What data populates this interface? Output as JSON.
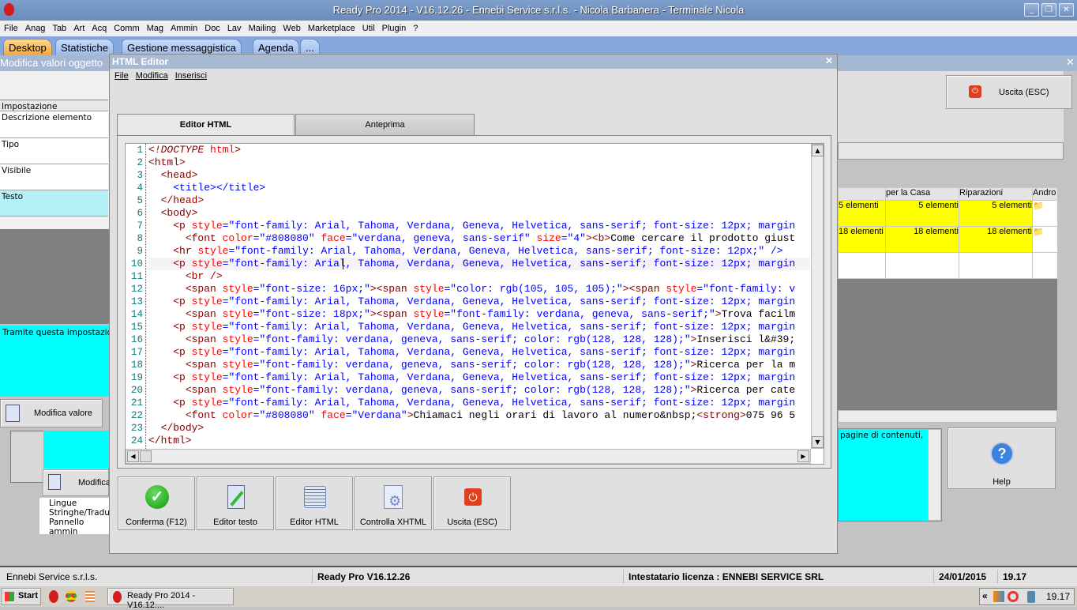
{
  "app": {
    "title": "Ready Pro 2014 - V16.12.26 - Ennebi Service s.r.l.s. - Nicola Barbanera - Terminale Nicola"
  },
  "menu": [
    "File",
    "Anag",
    "Tab",
    "Art",
    "Acq",
    "Comm",
    "Mag",
    "Ammin",
    "Doc",
    "Lav",
    "Mailing",
    "Web",
    "Marketplace",
    "Util",
    "Plugin",
    "?"
  ],
  "tabs": [
    {
      "label": "Desktop",
      "active": true
    },
    {
      "label": "Statistiche"
    },
    {
      "label": "Gestione messaggistica"
    },
    {
      "label": "Agenda"
    },
    {
      "label": "..."
    }
  ],
  "bg_window": {
    "title": "Modifica valori oggetto",
    "header": "Impostazione",
    "props": [
      "Descrizione elemento",
      "Tipo",
      "Visibile",
      "Testo"
    ],
    "description": "Tramite questa impostazione",
    "modify_label": "Modifica valore",
    "modify_label_2": "Modifica",
    "tree": [
      "Lingue",
      "Stringhe/Tradu",
      "Pannello ammin"
    ],
    "exit_label": "Uscita (ESC)",
    "help_label": "Help",
    "help_text": "pagine di contenuti,",
    "grid": {
      "columns": [
        "",
        "per la Casa",
        "Riparazioni",
        "Andro"
      ],
      "rows": [
        [
          "5 elementi",
          "5 elementi",
          "5 elementi",
          ""
        ],
        [
          "18 elementi",
          "18 elementi",
          "18 elementi",
          ""
        ]
      ]
    }
  },
  "editor": {
    "title": "HTML Editor",
    "menu": [
      "File",
      "Modifica",
      "Inserisci"
    ],
    "tabs": [
      "Editor HTML",
      "Anteprima"
    ],
    "active_tab": "Editor HTML",
    "lines": [
      [
        [
          "d",
          "<!DOCTYPE"
        ],
        [
          "a",
          " html"
        ],
        [
          "k",
          ">"
        ]
      ],
      [
        [
          "k",
          "<html>"
        ]
      ],
      [
        [
          "x",
          "  "
        ],
        [
          "k",
          "<head>"
        ]
      ],
      [
        [
          "x",
          "    "
        ],
        [
          "b",
          "<title></title>"
        ]
      ],
      [
        [
          "x",
          "  "
        ],
        [
          "k",
          "</head>"
        ]
      ],
      [
        [
          "x",
          "  "
        ],
        [
          "k",
          "<body>"
        ]
      ],
      [
        [
          "x",
          "    "
        ],
        [
          "k",
          "<p "
        ],
        [
          "a",
          "style"
        ],
        [
          "v",
          "=\"font-family: Arial, Tahoma, Verdana, Geneva, Helvetica, sans-serif; font-size: 12px; margin"
        ]
      ],
      [
        [
          "x",
          "      "
        ],
        [
          "k",
          "<font "
        ],
        [
          "a",
          "color"
        ],
        [
          "v",
          "=\"#808080\" "
        ],
        [
          "a",
          "face"
        ],
        [
          "v",
          "=\"verdana, geneva, sans-serif\" "
        ],
        [
          "a",
          "size"
        ],
        [
          "v",
          "=\"4\""
        ],
        [
          "k",
          "><b>"
        ],
        [
          "x",
          "Come cercare il prodotto giust"
        ]
      ],
      [
        [
          "x",
          "    "
        ],
        [
          "k",
          "<hr "
        ],
        [
          "a",
          "style"
        ],
        [
          "v",
          "=\"font-family: Arial, Tahoma, Verdana, Geneva, Helvetica, sans-serif; font-size: 12px;\" />"
        ]
      ],
      [
        [
          "x",
          "    "
        ],
        [
          "k",
          "<p "
        ],
        [
          "a",
          "style"
        ],
        [
          "v",
          "=\"font-family: Arial, Tahoma, Verdana, Geneva, Helvetica, sans-serif; font-size: 12px; margin"
        ]
      ],
      [
        [
          "x",
          "      "
        ],
        [
          "k",
          "<br />"
        ]
      ],
      [
        [
          "x",
          "      "
        ],
        [
          "k",
          "<span "
        ],
        [
          "a",
          "style"
        ],
        [
          "v",
          "=\"font-size: 16px;\""
        ],
        [
          "k",
          "><span "
        ],
        [
          "a",
          "style"
        ],
        [
          "v",
          "=\"color: rgb(105, 105, 105);\""
        ],
        [
          "k",
          "><span "
        ],
        [
          "a",
          "style"
        ],
        [
          "v",
          "=\"font-family: v"
        ]
      ],
      [
        [
          "x",
          "    "
        ],
        [
          "k",
          "<p "
        ],
        [
          "a",
          "style"
        ],
        [
          "v",
          "=\"font-family: Arial, Tahoma, Verdana, Geneva, Helvetica, sans-serif; font-size: 12px; margin"
        ]
      ],
      [
        [
          "x",
          "      "
        ],
        [
          "k",
          "<span "
        ],
        [
          "a",
          "style"
        ],
        [
          "v",
          "=\"font-size: 18px;\""
        ],
        [
          "k",
          "><span "
        ],
        [
          "a",
          "style"
        ],
        [
          "v",
          "=\"font-family: verdana, geneva, sans-serif;\""
        ],
        [
          "k",
          ">"
        ],
        [
          "x",
          "Trova facilm"
        ]
      ],
      [
        [
          "x",
          "    "
        ],
        [
          "k",
          "<p "
        ],
        [
          "a",
          "style"
        ],
        [
          "v",
          "=\"font-family: Arial, Tahoma, Verdana, Geneva, Helvetica, sans-serif; font-size: 12px; margin"
        ]
      ],
      [
        [
          "x",
          "      "
        ],
        [
          "k",
          "<span "
        ],
        [
          "a",
          "style"
        ],
        [
          "v",
          "=\"font-family: verdana, geneva, sans-serif; color: rgb(128, 128, 128);\""
        ],
        [
          "k",
          ">"
        ],
        [
          "x",
          "Inserisci l&#39;"
        ]
      ],
      [
        [
          "x",
          "    "
        ],
        [
          "k",
          "<p "
        ],
        [
          "a",
          "style"
        ],
        [
          "v",
          "=\"font-family: Arial, Tahoma, Verdana, Geneva, Helvetica, sans-serif; font-size: 12px; margin"
        ]
      ],
      [
        [
          "x",
          "      "
        ],
        [
          "k",
          "<span "
        ],
        [
          "a",
          "style"
        ],
        [
          "v",
          "=\"font-family: verdana, geneva, sans-serif; color: rgb(128, 128, 128);\""
        ],
        [
          "k",
          ">"
        ],
        [
          "x",
          "Ricerca per la m"
        ]
      ],
      [
        [
          "x",
          "    "
        ],
        [
          "k",
          "<p "
        ],
        [
          "a",
          "style"
        ],
        [
          "v",
          "=\"font-family: Arial, Tahoma, Verdana, Geneva, Helvetica, sans-serif; font-size: 12px; margin"
        ]
      ],
      [
        [
          "x",
          "      "
        ],
        [
          "k",
          "<span "
        ],
        [
          "a",
          "style"
        ],
        [
          "v",
          "=\"font-family: verdana, geneva, sans-serif; color: rgb(128, 128, 128);\""
        ],
        [
          "k",
          ">"
        ],
        [
          "x",
          "Ricerca per cate"
        ]
      ],
      [
        [
          "x",
          "    "
        ],
        [
          "k",
          "<p "
        ],
        [
          "a",
          "style"
        ],
        [
          "v",
          "=\"font-family: Arial, Tahoma, Verdana, Geneva, Helvetica, sans-serif; font-size: 12px; margin"
        ]
      ],
      [
        [
          "x",
          "      "
        ],
        [
          "k",
          "<font "
        ],
        [
          "a",
          "color"
        ],
        [
          "v",
          "=\"#808080\" "
        ],
        [
          "a",
          "face"
        ],
        [
          "v",
          "=\"Verdana\""
        ],
        [
          "k",
          ">"
        ],
        [
          "x",
          "Chiamaci negli orari di lavoro al numero&nbsp;"
        ],
        [
          "k",
          "<strong>"
        ],
        [
          "x",
          "075 96 5"
        ]
      ],
      [
        [
          "x",
          "  "
        ],
        [
          "k",
          "</body>"
        ]
      ],
      [
        [
          "k",
          "</html>"
        ]
      ]
    ],
    "current_line": 10,
    "buttons": [
      {
        "label": "Conferma (F12)",
        "icon": "check-icon"
      },
      {
        "label": "Editor testo",
        "icon": "edit-document-icon"
      },
      {
        "label": "Editor HTML",
        "icon": "html-editor-icon"
      },
      {
        "label": "Controlla XHTML",
        "icon": "gear-document-icon"
      },
      {
        "label": "Uscita (ESC)",
        "icon": "power-icon"
      }
    ]
  },
  "status": {
    "company": "Ennebi Service s.r.l.s.",
    "version": "Ready Pro V16.12.26",
    "license": "Intestatario licenza : ENNEBI SERVICE SRL",
    "date": "24/01/2015",
    "time": "19.17"
  },
  "taskbar": {
    "start": "Start",
    "task": "Ready Pro 2014 - V16.12....",
    "clock": "19.17",
    "tray_expand": "«"
  },
  "colors": {
    "titlebar": "#6a8cbc",
    "active_tab": "#f5a83a",
    "highlight_cyan": "#00ffff",
    "yellow_cell": "#ffff00"
  }
}
